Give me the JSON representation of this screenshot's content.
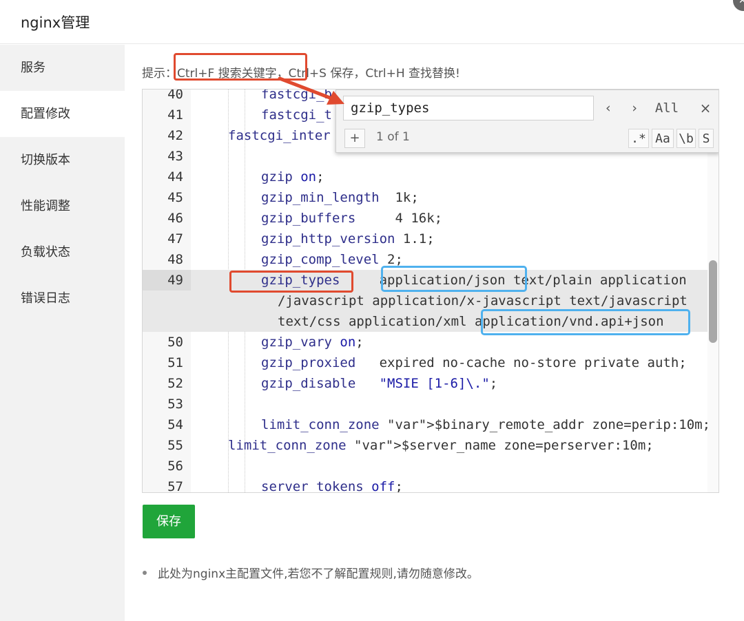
{
  "window": {
    "title": "nginx管理"
  },
  "sidebar": {
    "items": [
      {
        "label": "服务"
      },
      {
        "label": "配置修改"
      },
      {
        "label": "切换版本"
      },
      {
        "label": "性能调整"
      },
      {
        "label": "负载状态"
      },
      {
        "label": "错误日志"
      }
    ],
    "active_index": 1
  },
  "hint": {
    "prefix": "提示：",
    "text": "Ctrl+F 搜索关键字，Ctrl+S 保存，Ctrl+H 查找替换!"
  },
  "editor": {
    "highlight_line": 49,
    "lines": [
      {
        "num": "40",
        "code": "fastcgi_b"
      },
      {
        "num": "41",
        "code": "fastcgi_t"
      },
      {
        "num": "42",
        "code": "fastcgi_inter"
      },
      {
        "num": "43",
        "code": ""
      },
      {
        "num": "44",
        "code": "gzip on;"
      },
      {
        "num": "45",
        "code": "gzip_min_length  1k;"
      },
      {
        "num": "46",
        "code": "gzip_buffers     4 16k;"
      },
      {
        "num": "47",
        "code": "gzip_http_version 1.1;"
      },
      {
        "num": "48",
        "code": "gzip_comp_level 2;"
      },
      {
        "num": "49",
        "code": "gzip_types     application/json text/plain application"
      },
      {
        "num": "",
        "code": "/javascript application/x-javascript text/javascript"
      },
      {
        "num": "",
        "code": "text/css application/xml application/vnd.api+json"
      },
      {
        "num": "50",
        "code": "gzip_vary on;"
      },
      {
        "num": "51",
        "code": "gzip_proxied   expired no-cache no-store private auth;"
      },
      {
        "num": "52",
        "code": "gzip_disable   \"MSIE [1-6]\\.\";"
      },
      {
        "num": "53",
        "code": ""
      },
      {
        "num": "54",
        "code": "limit_conn_zone $binary_remote_addr zone=perip:10m;"
      },
      {
        "num": "55",
        "code": "limit_conn_zone $server_name zone=perserver:10m;"
      },
      {
        "num": "56",
        "code": ""
      },
      {
        "num": "57",
        "code": "server_tokens off;"
      }
    ]
  },
  "find_widget": {
    "query": "gzip_types",
    "prev_label": "‹",
    "next_label": "›",
    "all_label": "All",
    "close_label": "×",
    "expand_label": "+",
    "match_count": "1 of 1",
    "regex_label": ".*",
    "case_label": "Aa",
    "word_label": "\\b",
    "selection_label": "S"
  },
  "actions": {
    "save_label": "保存"
  },
  "note": {
    "text": "此处为nginx主配置文件,若您不了解配置规则,请勿随意修改。"
  },
  "colors": {
    "accent_green": "#20a53a",
    "annotation_red": "#e04a2f",
    "annotation_blue": "#4fb1ee"
  }
}
